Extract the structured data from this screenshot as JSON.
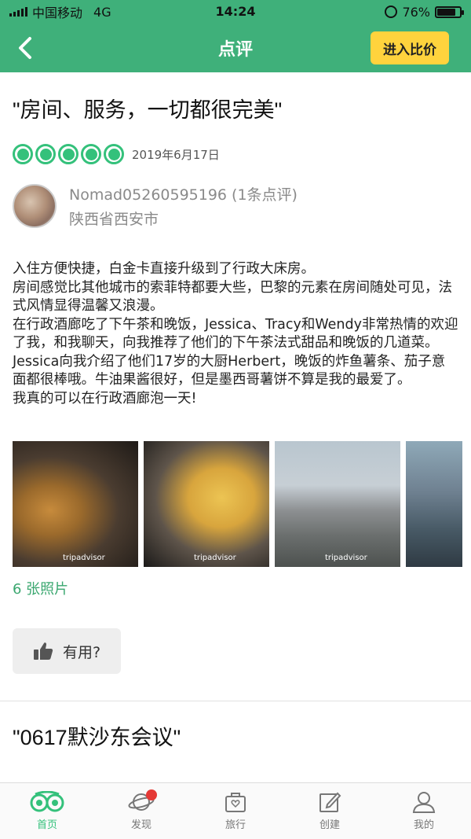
{
  "status_bar": {
    "carrier": "中国移动",
    "network": "4G",
    "time": "14:24",
    "battery": "76%",
    "battery_level": 0.76
  },
  "header": {
    "title": "点评",
    "compare_button": "进入比价"
  },
  "review": {
    "title": "\"房间、服务，一切都很完美\"",
    "rating": 5,
    "date": "2019年6月17日",
    "user": {
      "name": "Nomad05260595196 (1条点评)",
      "location": "陕西省西安市"
    },
    "body_lines": [
      "入住方便快捷，白金卡直接升级到了行政大床房。",
      "房间感觉比其他城市的索菲特都要大些，巴黎的元素在房间随处可见，法式风情显得温馨又浪漫。",
      "在行政酒廊吃了下午茶和晚饭，Jessica、Tracy和Wendy非常热情的欢迎了我，和我聊天，向我推荐了他们的下午茶法式甜品和晚饭的几道菜。",
      "Jessica向我介绍了他们17岁的大厨Herbert，晚饭的炸鱼薯条、茄子意面都很棒哦。牛油果酱很好，但是墨西哥薯饼不算是我的最爱了。",
      "我真的可以在行政酒廊泡一天!"
    ],
    "photo_watermark": "tripadvisor",
    "photo_count": "6 张照片",
    "helpful_label": "有用?"
  },
  "next_review": {
    "title": "\"0617默沙东会议\""
  },
  "tabbar": {
    "items": [
      {
        "label": "首页",
        "icon": "owl-icon",
        "active": true
      },
      {
        "label": "发现",
        "icon": "planet-icon",
        "badge": true
      },
      {
        "label": "旅行",
        "icon": "suitcase-icon"
      },
      {
        "label": "创建",
        "icon": "edit-icon"
      },
      {
        "label": "我的",
        "icon": "profile-icon"
      }
    ],
    "accent": "#34c17b"
  },
  "colors": {
    "header_bg": "#3fb07a",
    "compare_button_bg": "#ffd33d",
    "rating_green": "#34c17b",
    "badge_red": "#e53935"
  }
}
